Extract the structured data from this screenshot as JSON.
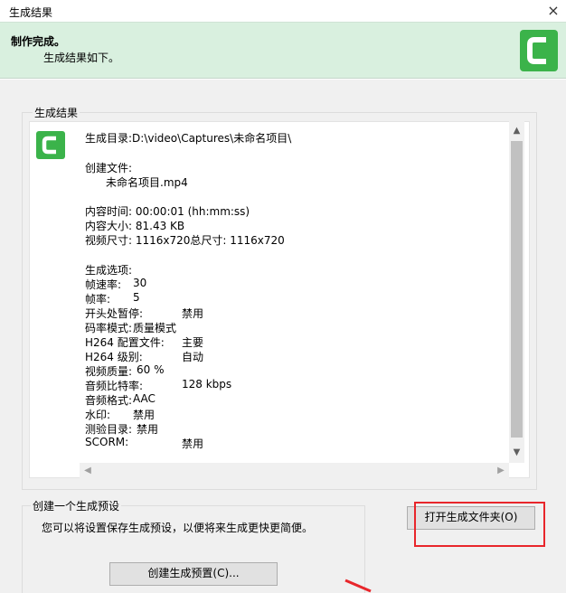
{
  "window": {
    "title": "生成结果",
    "close_glyph": "×"
  },
  "banner": {
    "heading": "制作完成。",
    "subheading": "生成结果如下。",
    "logo_icon": "camtasia-logo-icon"
  },
  "results": {
    "group_label": "生成结果",
    "output_dir": "生成目录:D:\\video\\Captures\\未命名项目\\",
    "created_label": "创建文件:",
    "created_file": "未命名项目.mp4",
    "duration": "内容时间: 00:00:01 (hh:mm:ss)",
    "size": "内容大小: 81.43 KB",
    "dimensions": "视频尺寸: 1116x720总尺寸:     1116x720",
    "options_label": "生成选项:",
    "options": [
      {
        "label": "帧速率:",
        "value": "30"
      },
      {
        "label": "帧率:",
        "value": "5"
      },
      {
        "label": "开头处暂停:",
        "value": "禁用"
      },
      {
        "label": "码率模式:",
        "value": "质量模式"
      },
      {
        "label": "H264 配置文件:",
        "value": "主要"
      },
      {
        "label": "H264 级别:",
        "value": "自动"
      },
      {
        "label": "视频质量:",
        "value": "60 %"
      },
      {
        "label": "音频比特率:",
        "value": "128 kbps"
      },
      {
        "label": "音频格式:",
        "value": "AAC"
      },
      {
        "label": "水印:",
        "value": "禁用"
      },
      {
        "label": "测验目录:",
        "value": "禁用"
      },
      {
        "label": "SCORM:",
        "value": "禁用"
      }
    ]
  },
  "preset": {
    "group_label": "创建一个生成预设",
    "description": "您可以将设置保存生成预设，以便将来生成更快更简便。",
    "create_button": "创建生成预置(C)..."
  },
  "actions": {
    "open_folder_button": "打开生成文件夹(O)"
  },
  "colors": {
    "banner_bg": "#d9f0df",
    "logo_green": "#3bb34a",
    "highlight_red": "#e8262b"
  }
}
